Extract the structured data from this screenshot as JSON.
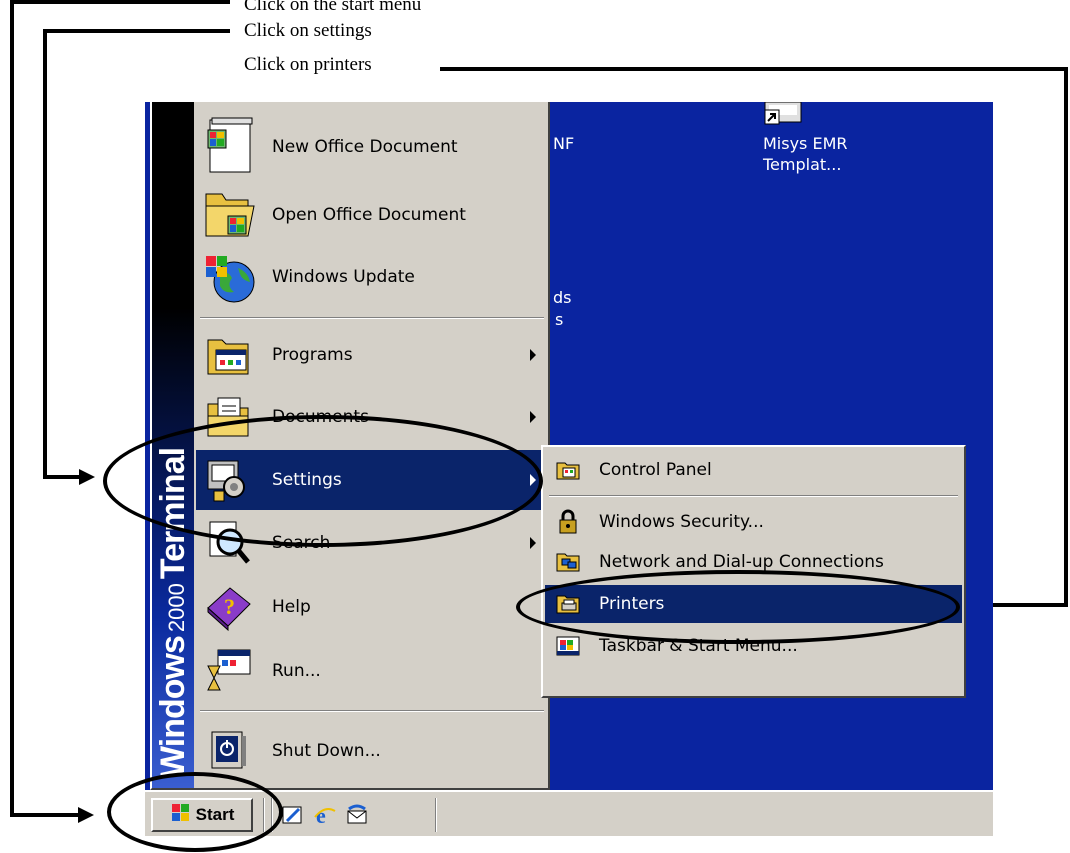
{
  "instructions": {
    "step1": "Click on the start menu",
    "step2": "Click on settings",
    "step3": "Click on printers"
  },
  "desktop": {
    "fragment_nf": "NF",
    "fragment_ds": "ds",
    "fragment_s": "s",
    "icon_label_line1": "Misys EMR",
    "icon_label_line2": "Templat...",
    "background_color": "#0a24a0"
  },
  "start_menu": {
    "banner_windows": "Windows",
    "banner_version": "2000",
    "banner_edition": "Terminal",
    "items": [
      {
        "label": "New Office Document",
        "icon": "new-office-document-icon"
      },
      {
        "label": "Open Office Document",
        "icon": "open-office-document-icon"
      },
      {
        "label": "Windows Update",
        "icon": "windows-update-icon"
      },
      {
        "label": "Programs",
        "icon": "programs-icon"
      },
      {
        "label": "Documents",
        "icon": "documents-icon"
      },
      {
        "label": "Settings",
        "icon": "settings-icon"
      },
      {
        "label": "Search",
        "icon": "search-icon"
      },
      {
        "label": "Help",
        "icon": "help-icon"
      },
      {
        "label": "Run...",
        "icon": "run-icon"
      },
      {
        "label": "Shut Down...",
        "icon": "shut-down-icon"
      }
    ]
  },
  "settings_submenu": {
    "items": [
      {
        "label": "Control Panel",
        "icon": "control-panel-icon"
      },
      {
        "label": "Windows Security...",
        "icon": "windows-security-icon"
      },
      {
        "label": "Network and Dial-up Connections",
        "icon": "network-icon"
      },
      {
        "label": "Printers",
        "icon": "printers-icon"
      },
      {
        "label": "Taskbar & Start Menu...",
        "icon": "taskbar-icon"
      }
    ]
  },
  "taskbar": {
    "start_label": "Start"
  },
  "colors": {
    "highlight": "#0a246a",
    "menu_face": "#d4d0c8"
  }
}
